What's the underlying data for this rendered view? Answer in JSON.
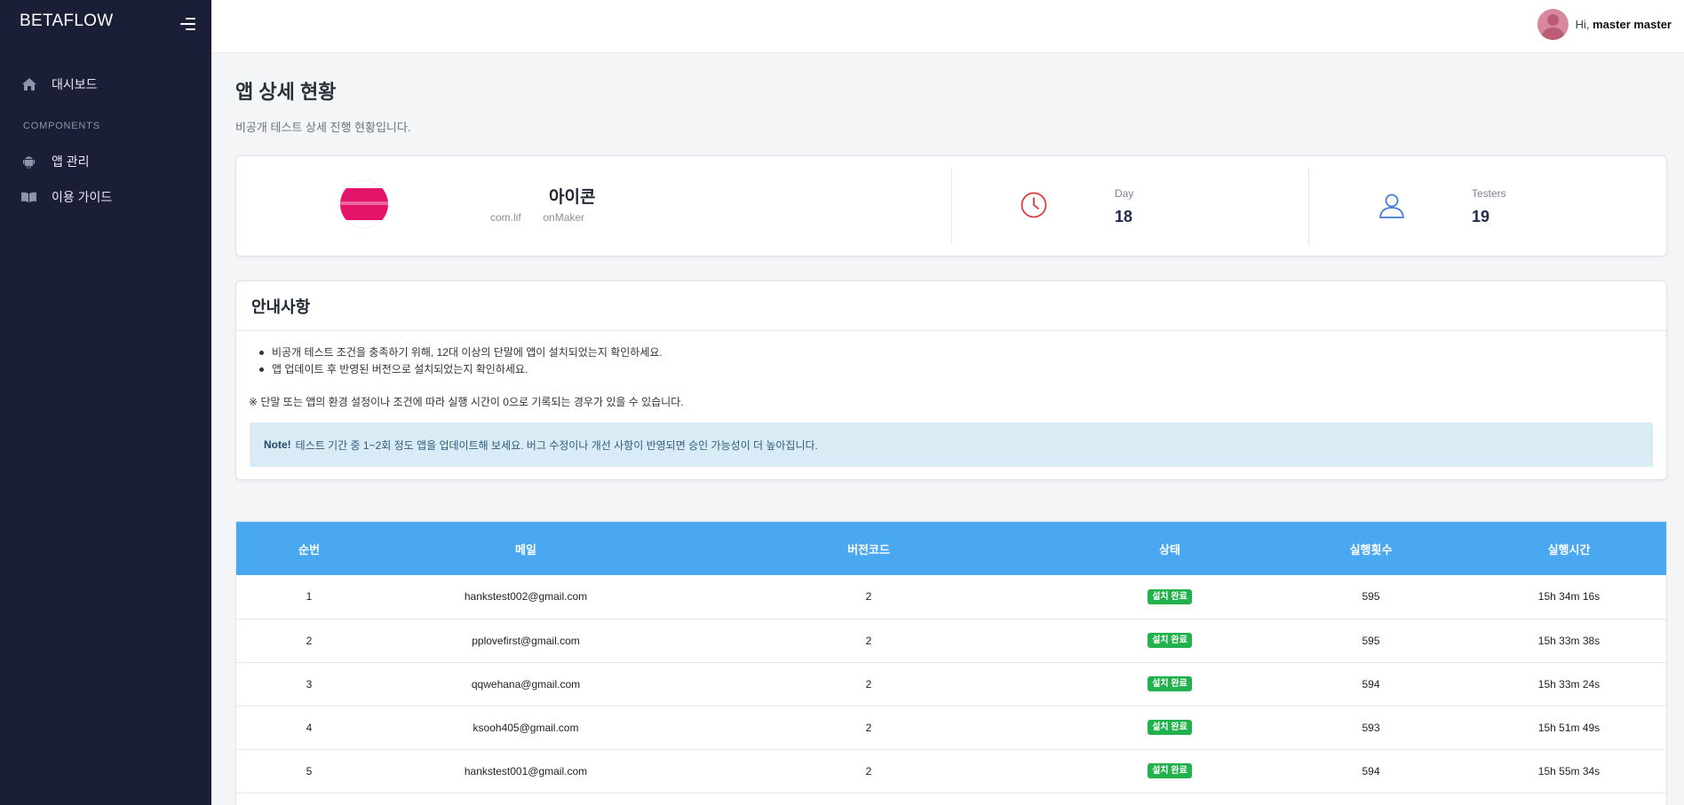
{
  "sidebar": {
    "brand": "BETAFLOW",
    "section_label": "COMPONENTS",
    "items": [
      {
        "label": "대시보드",
        "icon": "home-icon"
      },
      {
        "label": "앱 관리",
        "icon": "android-icon"
      },
      {
        "label": "이용 가이드",
        "icon": "book-icon"
      }
    ]
  },
  "topbar": {
    "greeting": "Hi,",
    "user_name": "master master"
  },
  "page": {
    "title": "앱 상세 현황",
    "subtitle": "비공개 테스트 상세 진행 현황입니다."
  },
  "summary": {
    "app_name": "아이콘",
    "app_package_prefix": "com.lif",
    "app_package_suffix": "onMaker",
    "day_label": "Day",
    "day_value": "18",
    "testers_label": "Testers",
    "testers_value": "19"
  },
  "notice": {
    "title": "안내사항",
    "bullets": [
      "비공개 테스트 조건을 충족하기 위해, 12대 이상의 단말에 앱이 설치되었는지 확인하세요.",
      "앱 업데이트 후 반영된 버전으로 설치되었는지 확인하세요."
    ],
    "remark": "※ 단말 또는 앱의 환경 설정이나 조건에 따라 실행 시간이 0으로 기록되는 경우가 있을 수 있습니다.",
    "note_label": "Note!",
    "note_text": "테스트 기간 중 1~2회 정도 앱을 업데이트해 보세요. 버그 수정이나 개선 사항이 반영되면 승인 가능성이 더 높아집니다."
  },
  "table": {
    "headers": [
      "순번",
      "메일",
      "버전코드",
      "상태",
      "실행횟수",
      "실행시간"
    ],
    "rows": [
      {
        "no": "1",
        "email": "hankstest002@gmail.com",
        "version": "2",
        "status": "설치 완료",
        "count": "595",
        "time": "15h 34m 16s"
      },
      {
        "no": "2",
        "email": "pplovefirst@gmail.com",
        "version": "2",
        "status": "설치 완료",
        "count": "595",
        "time": "15h 33m 38s"
      },
      {
        "no": "3",
        "email": "qqwehana@gmail.com",
        "version": "2",
        "status": "설치 완료",
        "count": "594",
        "time": "15h 33m 24s"
      },
      {
        "no": "4",
        "email": "ksooh405@gmail.com",
        "version": "2",
        "status": "설치 완료",
        "count": "593",
        "time": "15h 51m 49s"
      },
      {
        "no": "5",
        "email": "hankstest001@gmail.com",
        "version": "2",
        "status": "설치 완료",
        "count": "594",
        "time": "15h 55m 34s"
      }
    ]
  },
  "colors": {
    "sidebar_bg": "#1a1f37",
    "table_header": "#4aa8f1",
    "badge_success": "#22b14c",
    "day_icon": "#e03a3a",
    "testers_icon": "#3f7fd8"
  }
}
